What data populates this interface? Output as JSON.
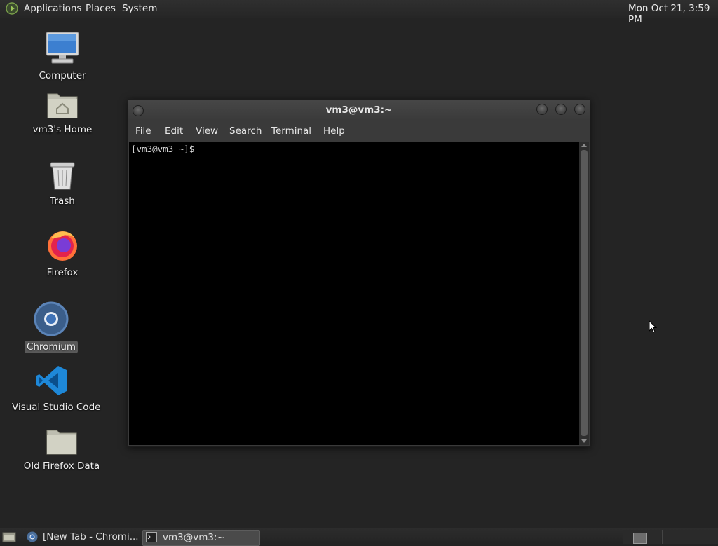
{
  "top_panel": {
    "menus": [
      "Applications",
      "Places",
      "System"
    ],
    "clock": "Mon Oct 21,  3:59 PM"
  },
  "desktop_icons": [
    {
      "label": "Computer",
      "icon": "computer-icon"
    },
    {
      "label": "vm3's Home",
      "icon": "home-folder-icon"
    },
    {
      "label": "Trash",
      "icon": "trash-icon"
    },
    {
      "label": "Firefox",
      "icon": "firefox-icon"
    },
    {
      "label": "Chromium",
      "icon": "chromium-icon",
      "selected": true
    },
    {
      "label": "Visual Studio Code",
      "icon": "vscode-icon"
    },
    {
      "label": "Old Firefox Data",
      "icon": "folder-icon"
    }
  ],
  "terminal": {
    "title": "vm3@vm3:~",
    "menu": [
      "File",
      "Edit",
      "View",
      "Search",
      "Terminal",
      "Help"
    ],
    "prompt": "[vm3@vm3 ~]$"
  },
  "taskbar": {
    "tasks": [
      {
        "label": "[New Tab - Chromi...",
        "icon": "chromium-icon"
      },
      {
        "label": "vm3@vm3:~",
        "icon": "terminal-icon",
        "active": true
      }
    ]
  }
}
